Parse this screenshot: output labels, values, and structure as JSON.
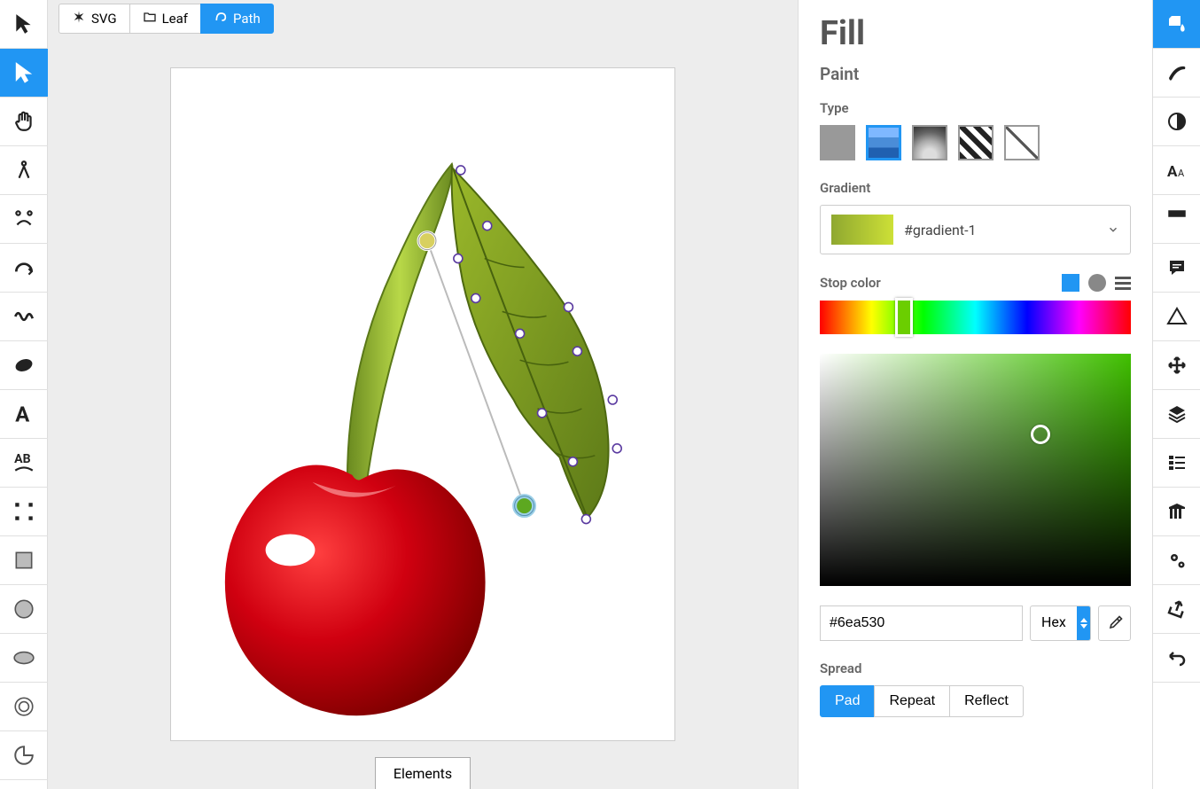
{
  "breadcrumb": [
    {
      "label": "SVG",
      "active": false
    },
    {
      "label": "Leaf",
      "active": false
    },
    {
      "label": "Path",
      "active": true
    }
  ],
  "bottom_tab": "Elements",
  "fill_panel": {
    "title": "Fill",
    "section_paint": "Paint",
    "type_label": "Type",
    "gradient_label": "Gradient",
    "gradient_name": "#gradient-1",
    "stop_color_label": "Stop color",
    "color_value": "#6ea530",
    "color_format": "Hex",
    "spread_label": "Spread",
    "spread_options": [
      "Pad",
      "Repeat",
      "Reflect"
    ],
    "spread_active": "Pad"
  }
}
